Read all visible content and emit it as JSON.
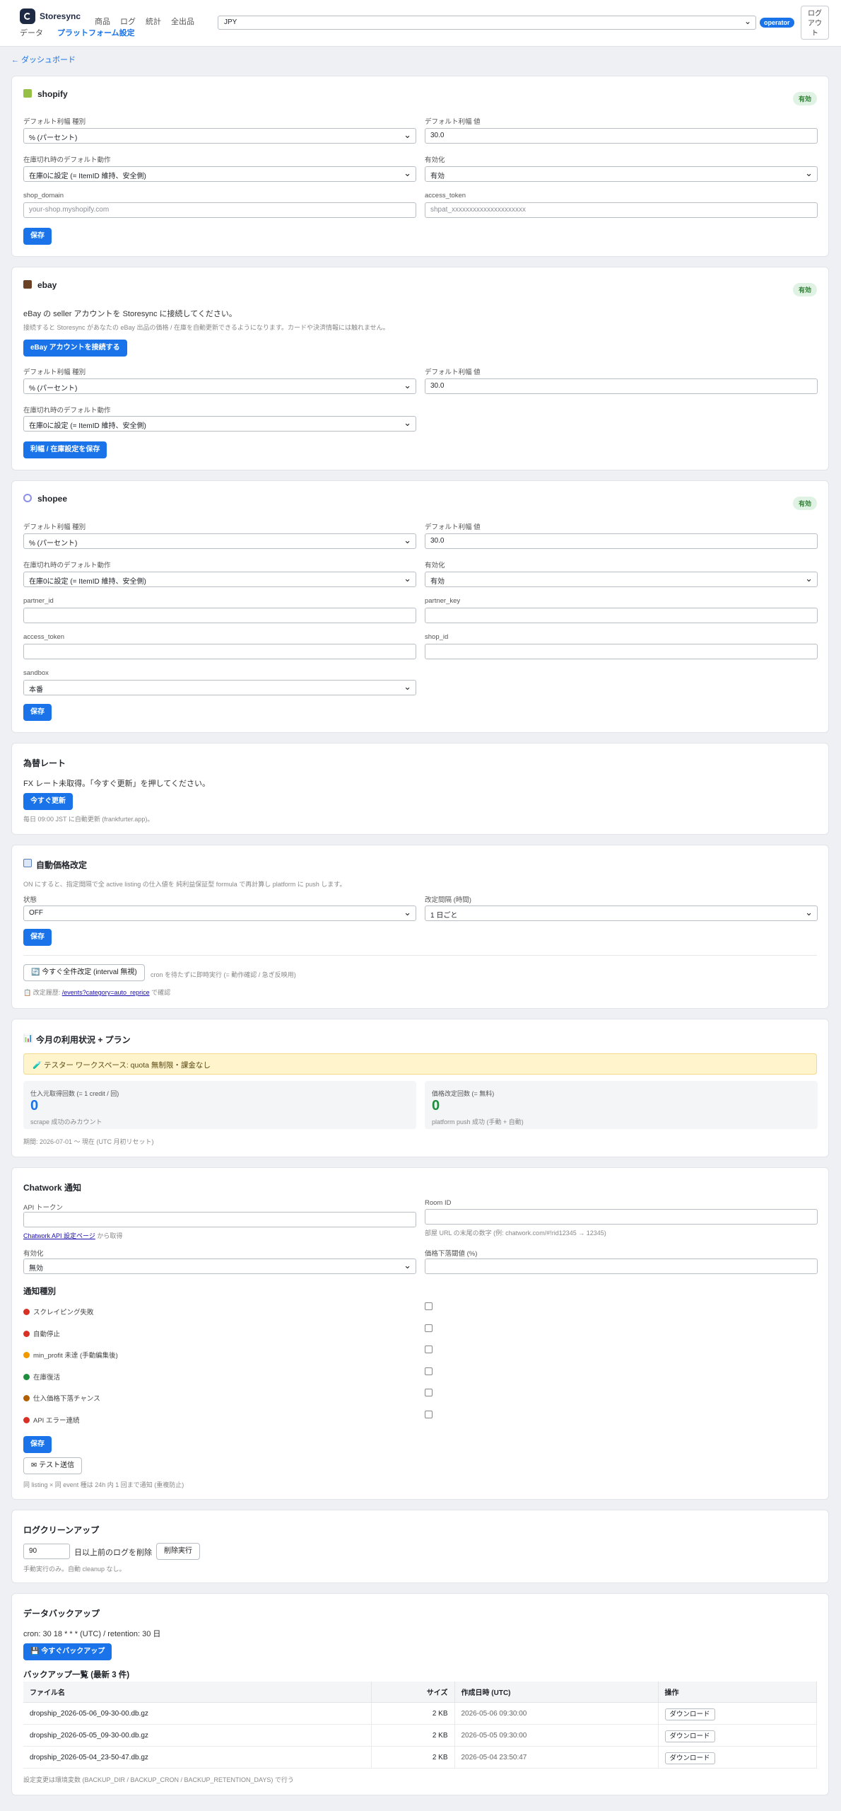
{
  "header": {
    "app_name": "Storesync",
    "nav_row1": [
      "商品",
      "ログ",
      "統計",
      "全出品"
    ],
    "nav_row2": [
      "データ",
      "プラットフォーム設定"
    ],
    "currency": "JPY",
    "role": "operator",
    "logout": "ログアウト"
  },
  "back_link": "← ダッシュボード",
  "shopify": {
    "title": "shopify",
    "badge": "有効",
    "margin_type_label": "デフォルト利幅 種別",
    "margin_type": "% (パーセント)",
    "margin_value_label": "デフォルト利幅 値",
    "margin_value": "30.0",
    "oos_label": "在庫切れ時のデフォルト動作",
    "oos": "在庫0に設定 (= ItemID 維持、安全側)",
    "enabled_label": "有効化",
    "enabled": "有効",
    "domain_label": "shop_domain",
    "domain_ph": "your-shop.myshopify.com",
    "token_label": "access_token",
    "token_ph": "shpat_xxxxxxxxxxxxxxxxxxxxx",
    "save": "保存"
  },
  "ebay": {
    "title": "ebay",
    "badge": "有効",
    "connect_text": "eBay の seller アカウントを Storesync に接続してください。",
    "connect_note": "接続すると Storesync があなたの eBay 出品の価格 / 在庫を自動更新できるようになります。カードや決済情報には触れません。",
    "connect_btn": "eBay アカウントを接続する",
    "margin_type_label": "デフォルト利幅 種別",
    "margin_type": "% (パーセント)",
    "margin_value_label": "デフォルト利幅 値",
    "margin_value": "30.0",
    "oos_label": "在庫切れ時のデフォルト動作",
    "oos": "在庫0に設定 (= ItemID 維持、安全側)",
    "save": "利幅 / 在庫設定を保存"
  },
  "shopee": {
    "title": "shopee",
    "badge": "有効",
    "margin_type_label": "デフォルト利幅 種別",
    "margin_type": "% (パーセント)",
    "margin_value_label": "デフォルト利幅 値",
    "margin_value": "30.0",
    "oos_label": "在庫切れ時のデフォルト動作",
    "oos": "在庫0に設定 (= ItemID 維持、安全側)",
    "enabled_label": "有効化",
    "enabled": "有効",
    "partner_id_label": "partner_id",
    "partner_key_label": "partner_key",
    "access_token_label": "access_token",
    "shop_id_label": "shop_id",
    "sandbox_label": "sandbox",
    "sandbox": "本番",
    "save": "保存"
  },
  "fx": {
    "title": "為替レート",
    "status": "FX レート未取得。「今すぐ更新」を押してください。",
    "btn": "今すぐ更新",
    "note": "毎日 09:00 JST に自動更新 (frankfurter.app)。"
  },
  "reprice": {
    "title": "自動価格改定",
    "desc": "ON にすると、指定間隔で全 active listing の仕入値を 純利益保証型 formula で再計算し platform に push します。",
    "state_label": "状態",
    "state": "OFF",
    "interval_label": "改定間隔 (時間)",
    "interval": "1 日ごと",
    "save": "保存",
    "run_btn": "今すぐ全件改定 (interval 無視)",
    "run_note": "cron を待たずに即時実行 (= 動作確認 / 急ぎ反映用)",
    "history_prefix": "改定履歴:",
    "history_link": "/events?category=auto_reprice",
    "history_suffix": "で確認"
  },
  "usage": {
    "title": "今月の利用状況 + プラン",
    "banner": "テスター ワークスペース: quota 無制限・課金なし",
    "stat1_label": "仕入元取得回数 (= 1 credit / 回)",
    "stat1_value": "0",
    "stat1_note": "scrape 成功のみカウント",
    "stat2_label": "価格改定回数 (= 無料)",
    "stat2_value": "0",
    "stat2_note": "platform push 成功 (手動 + 自動)",
    "period": "期間: 2026-07-01 〜 現在 (UTC 月初リセット)"
  },
  "chatwork": {
    "title": "Chatwork 通知",
    "api_label": "API トークン",
    "api_link": "Chatwork API 設定ページ",
    "api_link_suffix": "から取得",
    "room_label": "Room ID",
    "room_note": "部屋 URL の末尾の数字 (例: chatwork.com/#!rid12345 → 12345)",
    "enabled_label": "有効化",
    "enabled": "無効",
    "threshold_label": "価格下落閾値 (%)",
    "types_title": "通知種別",
    "types": [
      "スクレイピング失敗",
      "自動停止",
      "min_profit 未達 (手動編集後)",
      "在庫復活",
      "仕入価格下落チャンス",
      "API エラー連続"
    ],
    "type_colors": [
      "#d93025",
      "#d93025",
      "#f29900",
      "#1e8e3e",
      "#b06000",
      "#d93025"
    ],
    "save": "保存",
    "test": "テスト送信",
    "note": "同 listing × 同 event 種は 24h 内 1 回まで通知 (重複防止)"
  },
  "cleanup": {
    "title": "ログクリーンアップ",
    "days": "90",
    "label": "日以上前のログを削除",
    "btn": "削除実行",
    "note": "手動実行のみ。自動 cleanup なし。"
  },
  "backup": {
    "title": "データバックアップ",
    "cron": "cron: 30 18 * * * (UTC) / retention: 30 日",
    "btn": "今すぐバックアップ",
    "list_title": "バックアップ一覧 (最新 3 件)",
    "columns": [
      "ファイル名",
      "サイズ",
      "作成日時 (UTC)",
      "操作"
    ],
    "rows": [
      [
        "dropship_2026-05-06_09-30-00.db.gz",
        "2 KB",
        "2026-05-06 09:30:00",
        "ダウンロード"
      ],
      [
        "dropship_2026-05-05_09-30-00.db.gz",
        "2 KB",
        "2026-05-05 09:30:00",
        "ダウンロード"
      ],
      [
        "dropship_2026-05-04_23-50-47.db.gz",
        "2 KB",
        "2026-05-04 23:50:47",
        "ダウンロード"
      ]
    ],
    "note": "設定変更は環境変数 (BACKUP_DIR / BACKUP_CRON / BACKUP_RETENTION_DAYS) で行う"
  }
}
